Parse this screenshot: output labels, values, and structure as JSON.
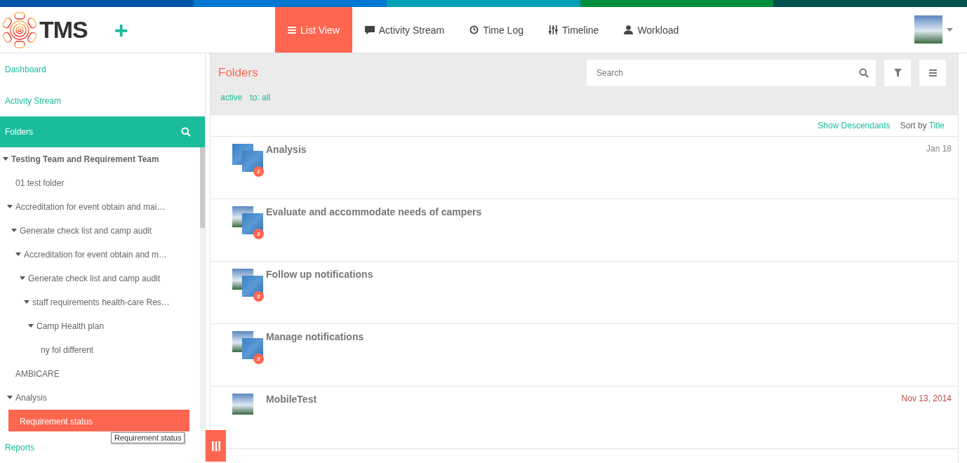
{
  "brand": {
    "name": "TMS",
    "add_icon": "+"
  },
  "nav_tabs": [
    {
      "label": "List View",
      "selected": true
    },
    {
      "label": "Activity Stream",
      "selected": false
    },
    {
      "label": "Time Log",
      "selected": false
    },
    {
      "label": "Timeline",
      "selected": false
    },
    {
      "label": "Workload",
      "selected": false
    }
  ],
  "sidebar": {
    "links": [
      "Dashboard",
      "Activity Stream"
    ],
    "folders_title": "Folders",
    "tree": [
      {
        "label": "Testing Team and Requirement Team",
        "expanded": true,
        "selected": false,
        "children": [
          {
            "label": "01 test folder",
            "selected": false
          },
          {
            "label": "Accreditation for event obtain and mai…",
            "expanded": true,
            "selected": false,
            "children": [
              {
                "label": "Generate check list and camp audit",
                "expanded": true,
                "selected": false,
                "children": [
                  {
                    "label": "Accreditation for event obtain and m…",
                    "expanded": true,
                    "selected": false,
                    "children": [
                      {
                        "label": "Generate check list and camp audit",
                        "expanded": true,
                        "selected": false,
                        "children": [
                          {
                            "label": "staff requirements health-care Res…",
                            "expanded": true,
                            "selected": false,
                            "children": [
                              {
                                "label": "Camp Health plan",
                                "expanded": true,
                                "selected": false,
                                "children": [
                                  {
                                    "label": "ny fol different",
                                    "selected": false
                                  }
                                ]
                              }
                            ]
                          }
                        ]
                      }
                    ]
                  }
                ]
              }
            ]
          },
          {
            "label": "AMBICARE",
            "selected": false
          },
          {
            "label": "Analysis",
            "expanded": true,
            "selected": false,
            "children": [
              {
                "label": "Requirement status",
                "selected": true
              }
            ]
          }
        ]
      }
    ],
    "tooltip": "Requirement status",
    "footer_link": "Reports"
  },
  "main": {
    "title": "Folders",
    "search": {
      "placeholder": "Search"
    },
    "filters": [
      "active",
      "to: all"
    ],
    "show_descendants": "Show Descendants",
    "sort_label": "Sort by",
    "sort_value": "Title",
    "rows": [
      {
        "title": "Analysis",
        "kind": "stacked",
        "badge": "2",
        "date": "Jan 18",
        "overdue": false
      },
      {
        "title": "Evaluate and accommodate needs of campers",
        "kind": "mixed",
        "badge": "2"
      },
      {
        "title": "Follow up notifications",
        "kind": "mixed",
        "badge": "2"
      },
      {
        "title": "Manage notifications",
        "kind": "mixed",
        "badge": "2"
      },
      {
        "title": "MobileTest",
        "kind": "single",
        "date": "Nov 13, 2014",
        "overdue": true
      }
    ]
  }
}
